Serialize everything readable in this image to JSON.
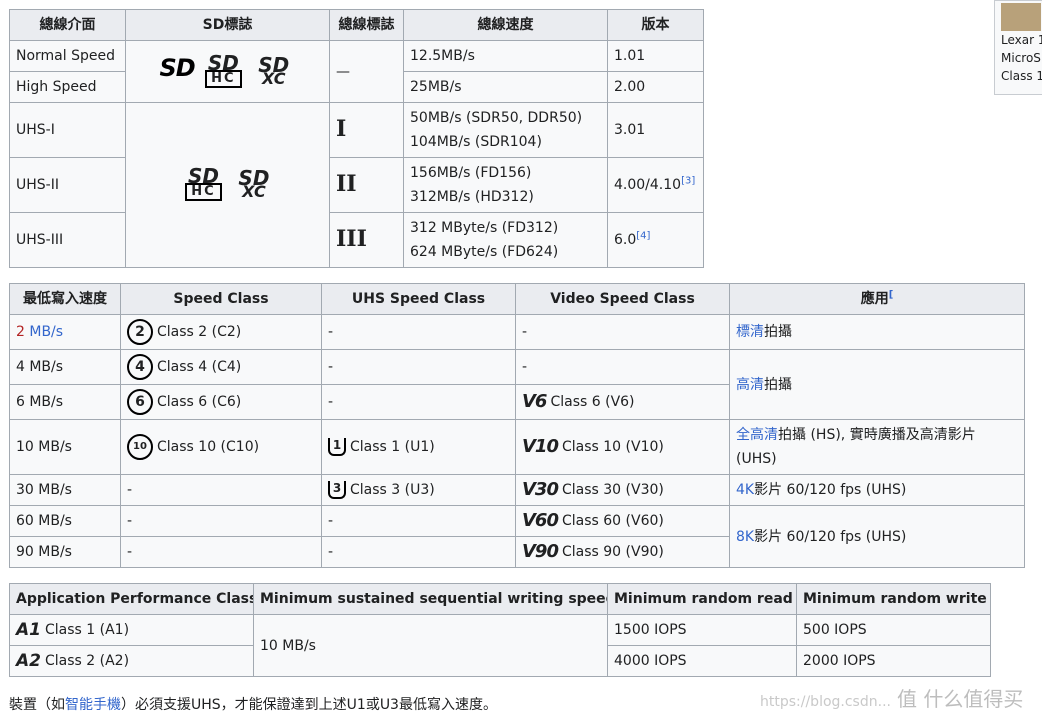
{
  "bus_table": {
    "headers": [
      "總線介面",
      "SD標誌",
      "總線標誌",
      "總線速度",
      "版本"
    ],
    "logos": {
      "sd": "SD",
      "sd_top": "SD",
      "hc": "HC",
      "xc": "XC"
    },
    "dash": "—",
    "rows": [
      {
        "iface": "Normal Speed",
        "speed1": "12.5MB/s",
        "ver": "1.01"
      },
      {
        "iface": "High Speed",
        "speed1": "25MB/s",
        "ver": "2.00"
      },
      {
        "iface": "UHS-I",
        "mark": "I",
        "speed1": "50MB/s  (SDR50, DDR50)",
        "speed2": "104MB/s  (SDR104)",
        "ver": "3.01"
      },
      {
        "iface": "UHS-II",
        "mark": "II",
        "speed1": "156MB/s  (FD156)",
        "speed2": "312MB/s  (HD312)",
        "ver": "4.00/4.10",
        "ref": "[3]"
      },
      {
        "iface": "UHS-III",
        "mark": "III",
        "speed1": "312 MByte/s (FD312)",
        "speed2": "624 MByte/s (FD624)",
        "ver": "6.0",
        "ref": "[4]"
      }
    ]
  },
  "speed_table": {
    "headers": [
      "最低寫入速度",
      "Speed Class",
      "UHS Speed Class",
      "Video Speed Class",
      "應用"
    ],
    "header_ref": "[",
    "dash": "-",
    "rows": [
      {
        "min_num": "2",
        "min_unit": "MB/s",
        "sc_icon": "2",
        "sc": "Class 2 (C2)"
      },
      {
        "min": "4 MB/s",
        "sc_icon": "4",
        "sc": "Class 4 (C4)"
      },
      {
        "min": "6 MB/s",
        "sc_icon": "6",
        "sc": "Class 6 (C6)",
        "v_icon": "V6",
        "vsc": "Class 6 (V6)"
      },
      {
        "min": "10 MB/s",
        "sc_icon": "10",
        "sc": "Class 10 (C10)",
        "u_icon": "1",
        "uhs": "Class 1 (U1)",
        "v_icon": "V10",
        "vsc": "Class 10 (V10)"
      },
      {
        "min": "30 MB/s",
        "u_icon": "3",
        "uhs": "Class 3 (U3)",
        "v_icon": "V30",
        "vsc": "Class 30 (V30)"
      },
      {
        "min": "60 MB/s",
        "v_icon": "V60",
        "vsc": "Class 60 (V60)"
      },
      {
        "min": "90 MB/s",
        "v_icon": "V90",
        "vsc": "Class 90 (V90)"
      }
    ],
    "apps": {
      "sd_link": "標清",
      "sd_text": "拍攝",
      "hd_link": "高清",
      "hd_text": "拍攝",
      "fhd_link": "全高清",
      "fhd_text": "拍攝 (HS), 實時廣播及高清影片",
      "fhd_text2": "(UHS)",
      "k4_link": "4K",
      "k4_text": "影片 60/120 fps (UHS)",
      "k8_link": "8K",
      "k8_text": "影片 60/120 fps (UHS)"
    }
  },
  "app_table": {
    "headers": [
      "Application Performance Class",
      "Minimum sustained sequential writing speed",
      "Minimum random read",
      "Minimum random write"
    ],
    "rows": [
      {
        "icon": "A1",
        "label": "Class 1 (A1)",
        "read": "1500 IOPS",
        "write": "500 IOPS"
      },
      {
        "icon": "A2",
        "label": "Class 2 (A2)",
        "read": "4000 IOPS",
        "write": "2000 IOPS"
      }
    ],
    "seq": "10 MB/s"
  },
  "note": {
    "pre": "裝置（如",
    "link": "智能手機",
    "post": "）必須支援UHS，才能保證達到上述U1或U3最低寫入速度。"
  },
  "thumb": {
    "lines": [
      "Lexar 1",
      "MicroS",
      "Class 1"
    ]
  },
  "watermark": {
    "url": "https://blog.csdn...",
    "brand": "值 什么值得买"
  }
}
